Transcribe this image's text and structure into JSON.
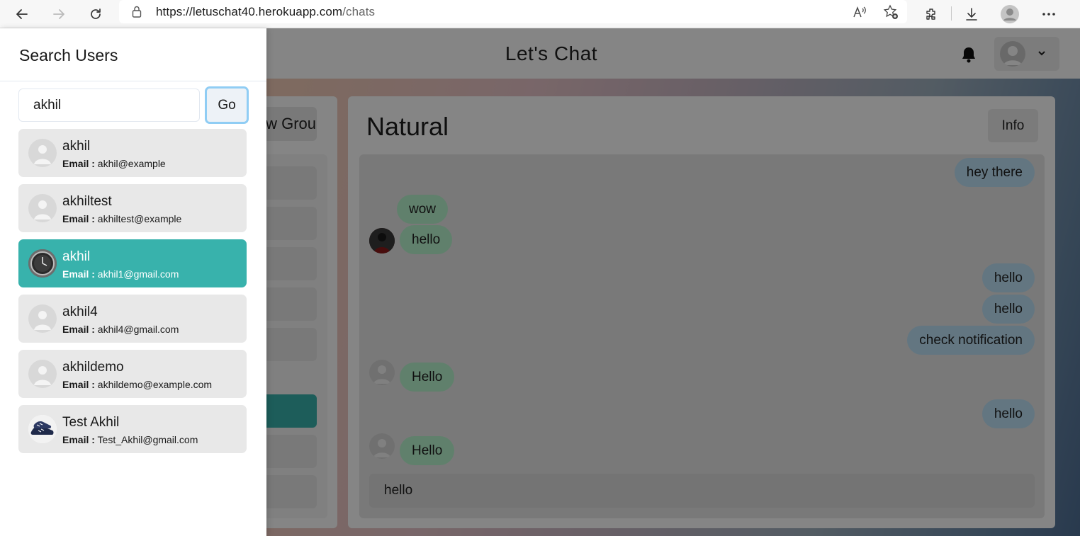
{
  "browser": {
    "url_host": "https://letuschat40.herokuapp.com",
    "url_path": "/chats"
  },
  "app": {
    "title": "Let's Chat",
    "new_chat_label": "New Group Chat +",
    "chat": {
      "name": "Natural",
      "info_label": "Info",
      "messages": [
        {
          "text": "hey there",
          "from": "me"
        },
        {
          "text": "wow",
          "from": "other"
        },
        {
          "text": "hello",
          "from": "other"
        },
        {
          "text": "hello",
          "from": "me"
        },
        {
          "text": "hello",
          "from": "me"
        },
        {
          "text": "check notification",
          "from": "me"
        },
        {
          "text": "Hello",
          "from": "other"
        },
        {
          "text": "hello",
          "from": "me"
        },
        {
          "text": "Hello",
          "from": "other"
        }
      ],
      "input_value": "hello"
    }
  },
  "drawer": {
    "title": "Search Users",
    "search_value": "akhil",
    "go_label": "Go",
    "email_label": "Email :",
    "users": [
      {
        "name": "akhil",
        "email": "akhil@example",
        "avatar": "default-avatar-icon"
      },
      {
        "name": "akhiltest",
        "email": "akhiltest@example",
        "avatar": "default-avatar-icon"
      },
      {
        "name": "akhil",
        "email": "akhil1@gmail.com",
        "avatar": "watch-photo",
        "selected": true
      },
      {
        "name": "akhil4",
        "email": "akhil4@gmail.com",
        "avatar": "default-avatar-icon"
      },
      {
        "name": "akhildemo",
        "email": "akhildemo@example.com",
        "avatar": "default-avatar-icon"
      },
      {
        "name": "Test Akhil",
        "email": "Test_Akhil@gmail.com",
        "avatar": "shoe-photo"
      }
    ]
  },
  "colors": {
    "accent": "#38b2ac",
    "sent_bubble": "#bee3f8",
    "received_bubble": "#b9f5d0"
  }
}
